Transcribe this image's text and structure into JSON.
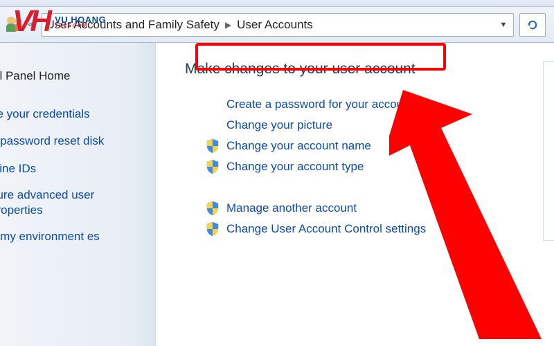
{
  "breadcrumb": {
    "part1": "User Accounts and Family Safety",
    "part2": "User Accounts"
  },
  "sidebar": {
    "home": "ol Panel Home",
    "links": [
      "ge your credentials",
      "a password reset disk",
      "nline IDs",
      "gure advanced user properties",
      "e my environment es"
    ]
  },
  "main": {
    "heading": "Make changes to your user account",
    "tasks_group1": [
      {
        "label": "Create a password for your account",
        "shield": false
      },
      {
        "label": "Change your picture",
        "shield": false
      },
      {
        "label": "Change your account name",
        "shield": true
      },
      {
        "label": "Change your account type",
        "shield": true
      }
    ],
    "tasks_group2": [
      {
        "label": "Manage another account",
        "shield": true
      },
      {
        "label": "Change User Account Control settings",
        "shield": true
      }
    ]
  },
  "watermark": {
    "logo": "VH",
    "line1": "VU HOANG",
    "line2": "TELECOM"
  }
}
